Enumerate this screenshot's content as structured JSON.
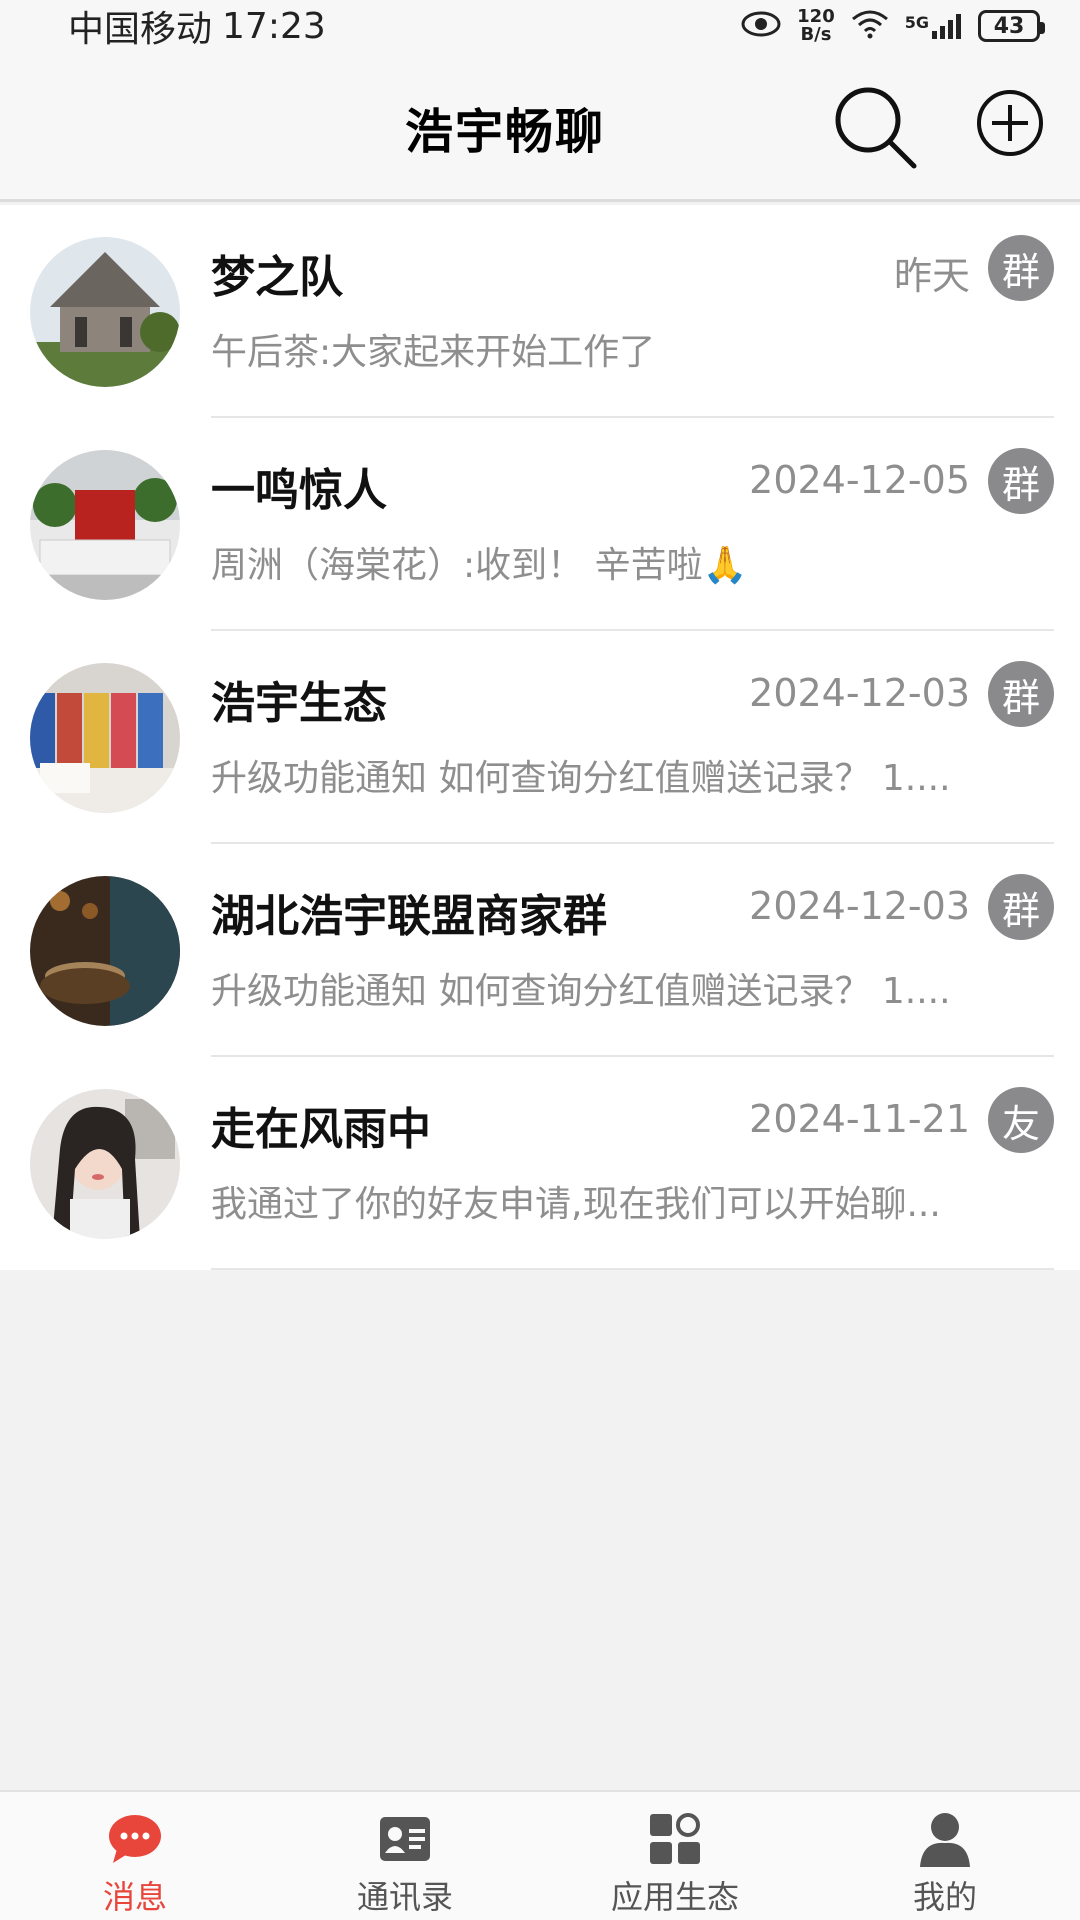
{
  "status_bar": {
    "carrier": "中国移动",
    "time": "17:23",
    "speed_top": "120",
    "speed_bottom": "B/s",
    "network": "5G",
    "battery": "43"
  },
  "header": {
    "title": "浩宇畅聊"
  },
  "conversations": [
    {
      "name": "梦之队",
      "time": "昨天",
      "badge": "群",
      "preview": "午后茶:大家起来开始工作了"
    },
    {
      "name": "一鸣惊人",
      "time": "2024-12-05",
      "badge": "群",
      "preview": "周洲（海棠花）:收到！ 辛苦啦🙏"
    },
    {
      "name": "浩宇生态",
      "time": "2024-12-03",
      "badge": "群",
      "preview": "升级功能通知 如何查询分红值赠送记录？ 1...."
    },
    {
      "name": "湖北浩宇联盟商家群",
      "time": "2024-12-03",
      "badge": "群",
      "preview": "升级功能通知 如何查询分红值赠送记录？ 1...."
    },
    {
      "name": "走在风雨中",
      "time": "2024-11-21",
      "badge": "友",
      "preview": "我通过了你的好友申请,现在我们可以开始聊..."
    }
  ],
  "bottom_nav": {
    "items": [
      {
        "label": "消息",
        "icon": "chat-bubble-icon",
        "active": true
      },
      {
        "label": "通讯录",
        "icon": "contact-card-icon",
        "active": false
      },
      {
        "label": "应用生态",
        "icon": "apps-grid-icon",
        "active": false
      },
      {
        "label": "我的",
        "icon": "person-icon",
        "active": false
      }
    ]
  },
  "colors": {
    "accent": "#e8463a",
    "badge_bg": "#8a8a8c",
    "muted_text": "#8e8e8e"
  }
}
